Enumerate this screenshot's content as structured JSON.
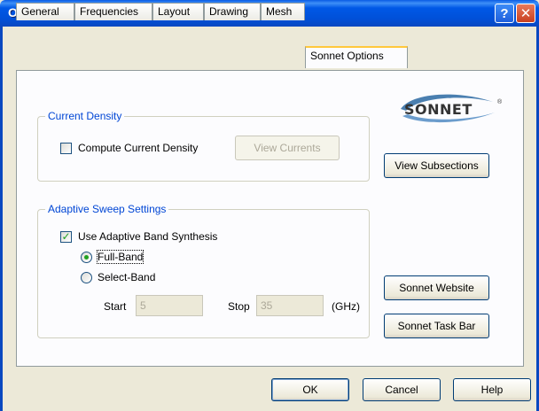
{
  "window": {
    "title": "Options",
    "help_glyph": "?",
    "close_glyph": "✕"
  },
  "tabs": [
    {
      "label": "General"
    },
    {
      "label": "Frequencies"
    },
    {
      "label": "Layout"
    },
    {
      "label": "Drawing"
    },
    {
      "label": "Mesh"
    },
    {
      "label": "Sonnet Options",
      "active": true
    }
  ],
  "logo": {
    "text": "SONNET",
    "reg_mark": "®"
  },
  "current_density": {
    "legend": "Current Density",
    "compute_label": "Compute Current Density",
    "compute_checked": false,
    "view_currents_label": "View Currents",
    "view_currents_enabled": false
  },
  "adaptive_sweep": {
    "legend": "Adaptive Sweep Settings",
    "use_abs_label": "Use Adaptive Band Synthesis",
    "use_abs_checked": true,
    "full_band_label": "Full-Band",
    "select_band_label": "Select-Band",
    "selected": "Full-Band",
    "start_label": "Start",
    "start_value": "5",
    "stop_label": "Stop",
    "stop_value": "35",
    "unit_label": "(GHz)"
  },
  "side_buttons": {
    "view_subsections": "View Subsections",
    "sonnet_website": "Sonnet Website",
    "sonnet_task_bar": "Sonnet Task Bar"
  },
  "footer": {
    "ok": "OK",
    "cancel": "Cancel",
    "help": "Help"
  },
  "colors": {
    "title_bar": "#0058e6",
    "group_legend": "#0046d5",
    "check_mark": "#21a121"
  }
}
